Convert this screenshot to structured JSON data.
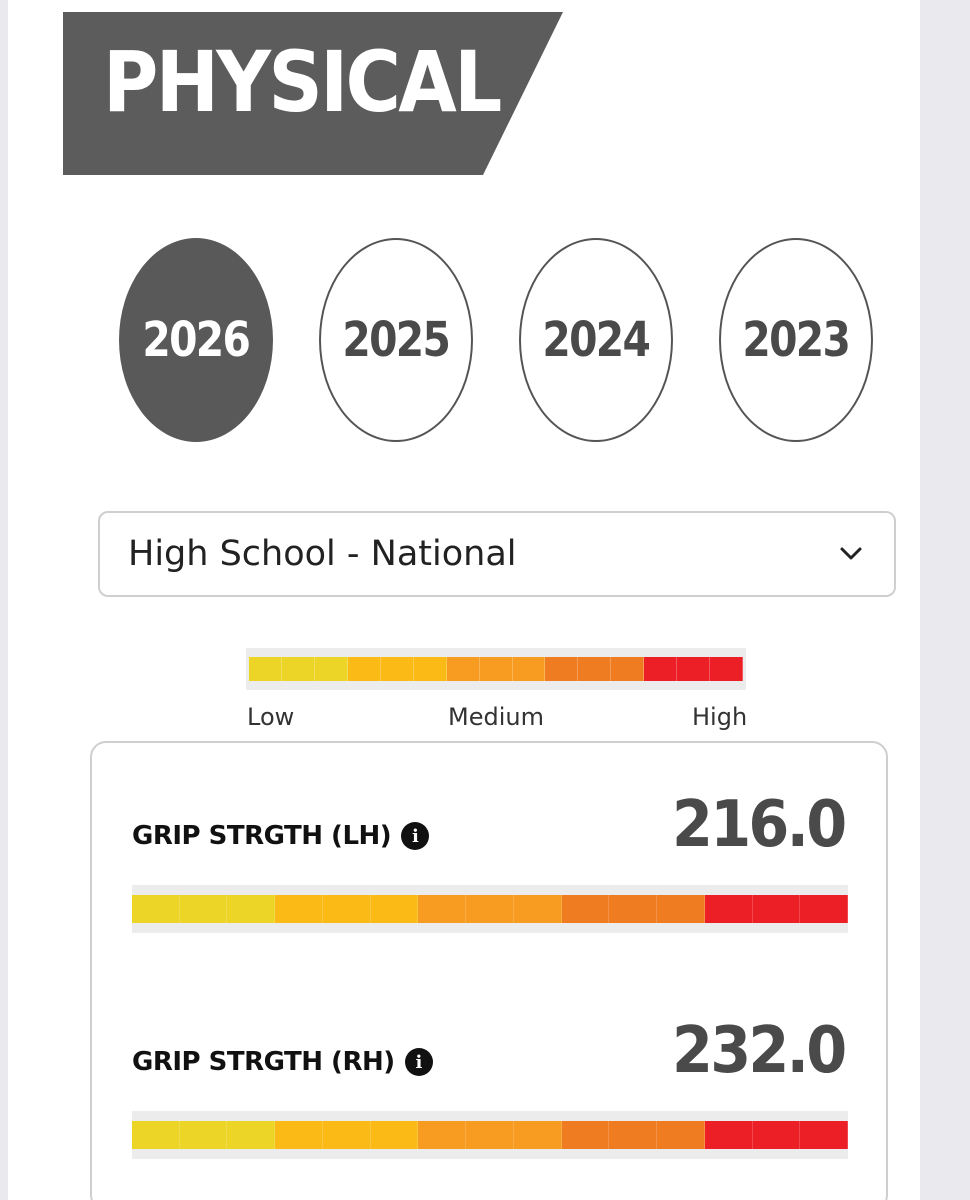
{
  "section": {
    "title": "PHYSICAL"
  },
  "years": [
    {
      "label": "2026",
      "selected": true
    },
    {
      "label": "2025",
      "selected": false
    },
    {
      "label": "2024",
      "selected": false
    },
    {
      "label": "2023",
      "selected": false
    }
  ],
  "filter": {
    "selected": "High School - National"
  },
  "scale": {
    "low_label": "Low",
    "medium_label": "Medium",
    "high_label": "High",
    "colors": [
      "#ecd526",
      "#ecd526",
      "#ecd526",
      "#fbba16",
      "#fbba16",
      "#fbba16",
      "#f79c20",
      "#f79c20",
      "#f79c20",
      "#f07c22",
      "#f07c22",
      "#f07c22",
      "#ec1f26",
      "#ec1f26",
      "#ec1f26"
    ]
  },
  "metrics": [
    {
      "label": "GRIP STRGTH (LH)",
      "value": "216.0"
    },
    {
      "label": "GRIP STRGTH (RH)",
      "value": "232.0"
    }
  ]
}
